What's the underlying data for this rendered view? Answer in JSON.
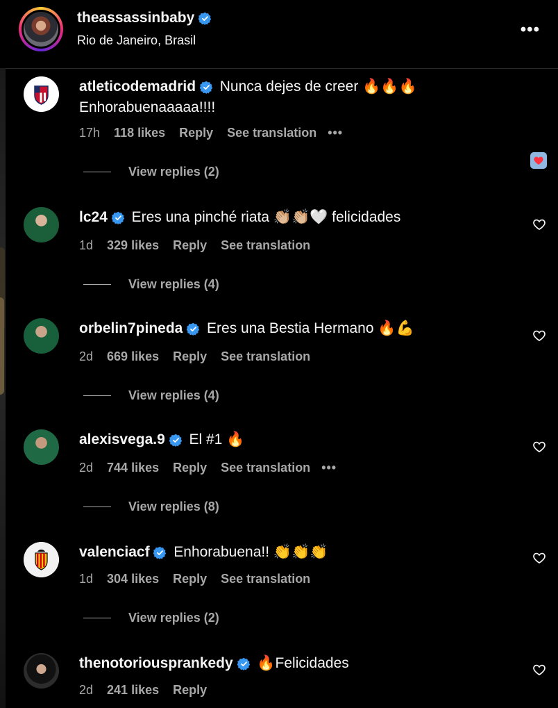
{
  "header": {
    "username": "theassassinbaby",
    "location": "Rio de Janeiro, Brasil",
    "more_icon": "•••"
  },
  "comments": [
    {
      "username": "atleticodemadrid",
      "text": "Nunca dejes de creer 🔥🔥🔥",
      "text2": "Enhorabuenaaaaa!!!!",
      "time": "17h",
      "likes": "118 likes",
      "reply": "Reply",
      "translation": "See translation",
      "more": "•••",
      "view_replies": "View replies (2)",
      "liked": true
    },
    {
      "username": "lc24",
      "text": "Eres una pinché riata 👏🏼👏🏼🤍 felicidades",
      "time": "1d",
      "likes": "329 likes",
      "reply": "Reply",
      "translation": "See translation",
      "view_replies": "View replies (4)",
      "liked": false
    },
    {
      "username": "orbelin7pineda",
      "text": "Eres una Bestia Hermano 🔥💪",
      "time": "2d",
      "likes": "669 likes",
      "reply": "Reply",
      "translation": "See translation",
      "view_replies": "View replies (4)",
      "liked": false
    },
    {
      "username": "alexisvega.9",
      "text": "El #1 🔥",
      "time": "2d",
      "likes": "744 likes",
      "reply": "Reply",
      "translation": "See translation",
      "more": "•••",
      "view_replies": "View replies (8)",
      "liked": false
    },
    {
      "username": "valenciacf",
      "text": "Enhorabuena!! 👏👏👏",
      "time": "1d",
      "likes": "304 likes",
      "reply": "Reply",
      "translation": "See translation",
      "view_replies": "View replies (2)",
      "liked": false
    },
    {
      "username": "thenotoriousprankedy",
      "text": "🔥Felicidades",
      "time": "2d",
      "likes": "241 likes",
      "reply": "Reply",
      "liked": false
    }
  ],
  "colors": {
    "background": "#000000",
    "text": "#f5f5f5",
    "secondary_text": "#a8a8a8",
    "verified": "#0095f6",
    "liked_badge": "#8fb7df",
    "liked_heart": "#ff3040"
  }
}
